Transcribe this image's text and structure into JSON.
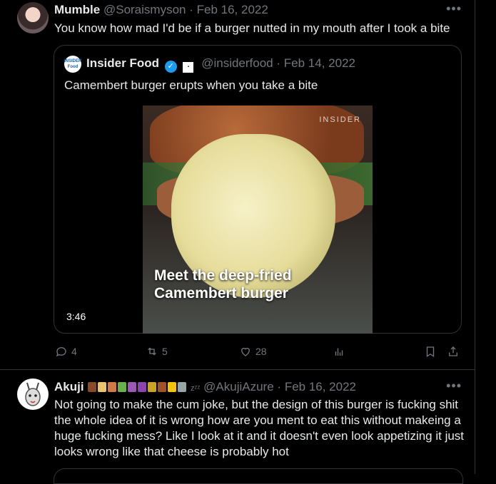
{
  "tweet1": {
    "name": "Mumble",
    "handle": "@Soraismyson",
    "date": "Feb 16, 2022",
    "text": "You know how mad I'd be if a burger nutted in my mouth after I took a bite",
    "quote": {
      "avatar_text": "INSIDER Food",
      "name": "Insider Food",
      "handle": "@insiderfood",
      "date": "Feb 14, 2022",
      "text": "Camembert burger erupts when you take a bite",
      "video_watermark": "INSIDER",
      "video_caption": "Meet the deep-fried\nCamembert burger",
      "duration": "3:46"
    },
    "actions": {
      "replies": "4",
      "reposts": "5",
      "likes": "28"
    }
  },
  "tweet2": {
    "name": "Akuji",
    "handle": "@AkujiAzure",
    "date": "Feb 16, 2022",
    "text": "Not going to make the cum joke, but the design of this burger is fucking shit the whole idea of it is wrong how are you ment to eat this without makeing a huge fucking mess? Like I look at it and it doesn't even look appetizing it just looks wrong like that cheese is probably hot"
  },
  "icons": [
    "more-icon",
    "verified-icon",
    "reply-icon",
    "repost-icon",
    "like-icon",
    "views-icon",
    "bookmark-icon",
    "share-icon"
  ],
  "colors": {
    "background": "#000000",
    "text": "#e7e9ea",
    "muted": "#71767b",
    "verified": "#1d9bf0",
    "border": "#2f3336"
  }
}
